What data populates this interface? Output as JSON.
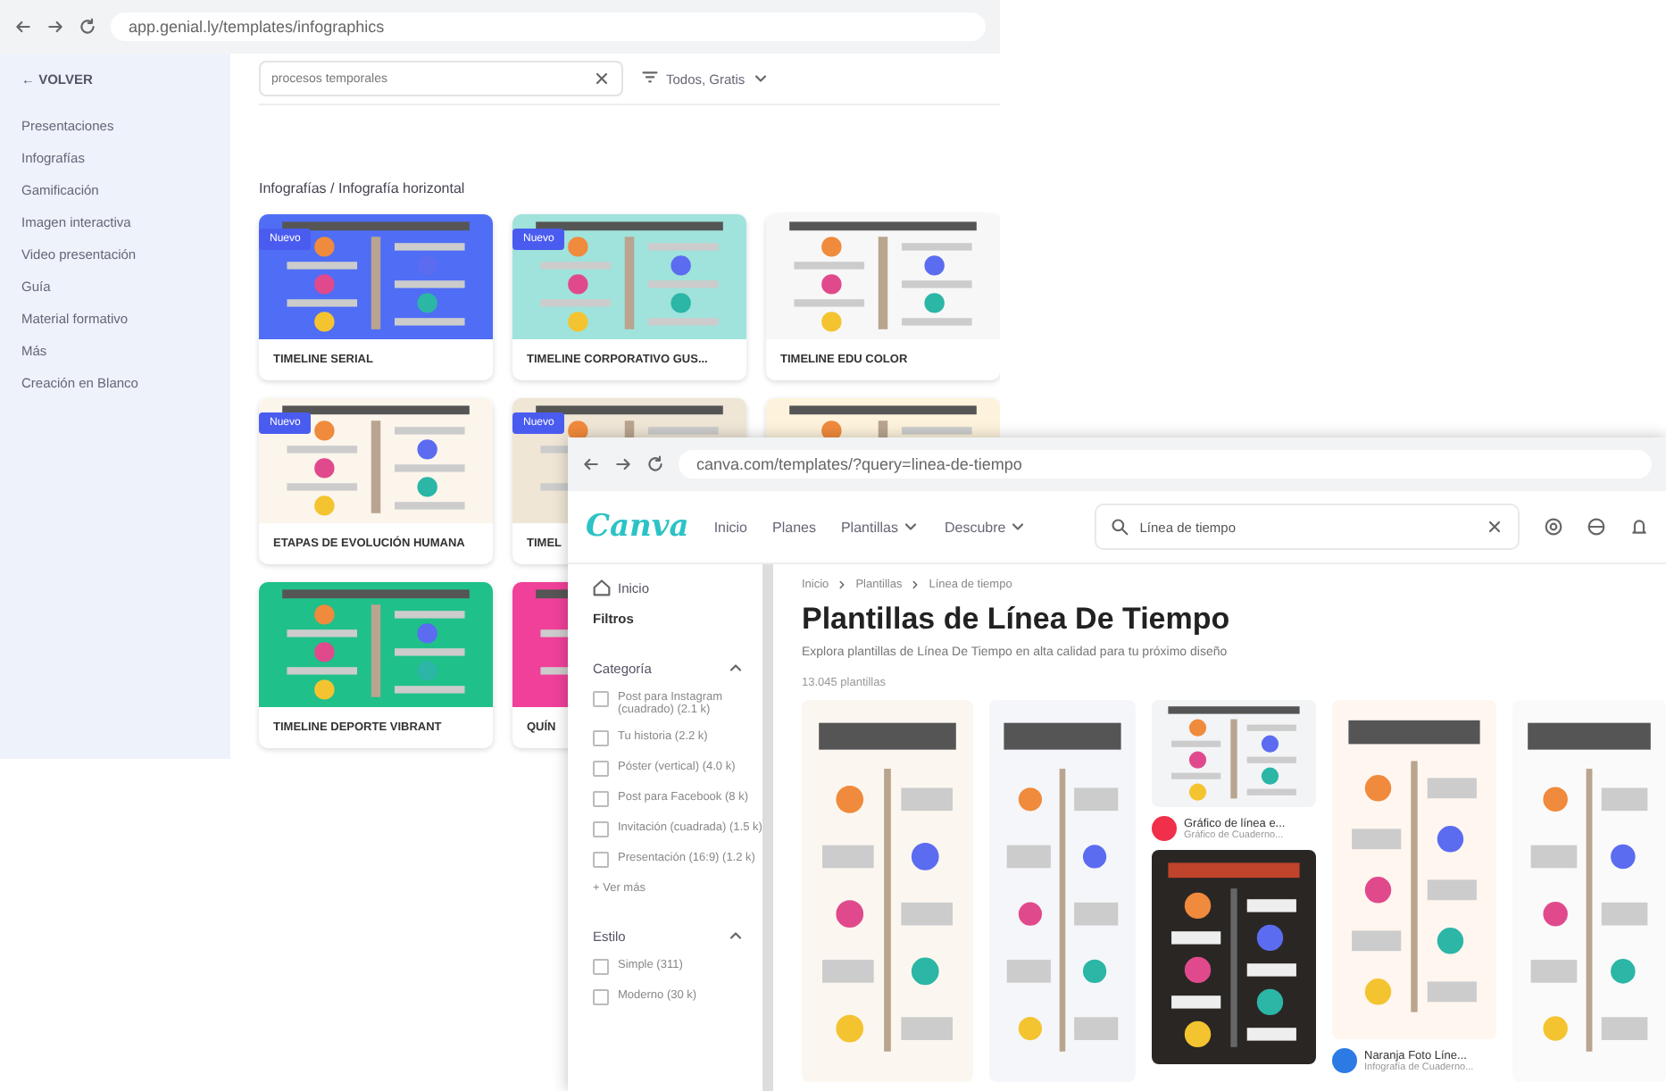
{
  "back_window": {
    "url": "app.genial.ly/templates/infographics",
    "back_link": "← VOLVER",
    "sidebar": {
      "items": [
        "Presentaciones",
        "Infografías",
        "Gamificación",
        "Imagen interactiva",
        "Video presentación",
        "Guía",
        "Material formativo",
        "Más",
        "Creación en Blanco"
      ]
    },
    "search": {
      "value": "procesos temporales"
    },
    "filter": {
      "label": "Todos, Gratis"
    },
    "heading": "Infografías / Infografía horizontal",
    "cards": [
      {
        "title": "TIMELINE SERIAL",
        "badge": "Nuevo",
        "kind": "picture"
      },
      {
        "title": "TIMELINE CORPORATIVO GUS...",
        "badge": "Nuevo",
        "kind": "picture"
      },
      {
        "title": "TIMELINE EDU COLOR",
        "kind": "picture"
      },
      {
        "title": "ETAPAS DE EVOLUCIÓN HUMANA",
        "badge": "Nuevo",
        "kind": "picture"
      },
      {
        "title": "TIMEL",
        "badge": "Nuevo",
        "kind": "picture"
      },
      {
        "kind": "picture"
      },
      {
        "title": "TIMELINE DEPORTE VIBRANT",
        "kind": "picture"
      },
      {
        "title": "QUÍN",
        "kind": "picture"
      }
    ]
  },
  "front_window": {
    "url": "canva.com/templates/?query=linea-de-tiempo",
    "logo": "Canva",
    "nav": [
      {
        "label": "Inicio",
        "dropdown": false
      },
      {
        "label": "Planes",
        "dropdown": false
      },
      {
        "label": "Plantillas",
        "dropdown": true
      },
      {
        "label": "Descubre",
        "dropdown": true
      }
    ],
    "search": {
      "value": "Línea de tiempo"
    },
    "sidebar": {
      "home": "Inicio",
      "filters": "Filtros",
      "groups": [
        {
          "title": "Categoría",
          "expanded": true,
          "options": [
            {
              "label": "Post para Instagram (cuadrado) (2.1 k)",
              "checked": false
            },
            {
              "label": "Tu historia (2.2 k)",
              "checked": false
            },
            {
              "label": "Póster (vertical) (4.0 k)",
              "checked": false
            },
            {
              "label": "Post para Facebook (8 k)",
              "checked": false
            },
            {
              "label": "Invitación (cuadrada) (1.5 k)",
              "checked": false
            },
            {
              "label": "Presentación (16:9) (1.2 k)",
              "checked": false
            }
          ],
          "more": "+ Ver más"
        },
        {
          "title": "Estilo",
          "expanded": true,
          "options": [
            {
              "label": "Simple (311)",
              "checked": false
            },
            {
              "label": "Moderno (30 k)",
              "checked": false
            }
          ]
        }
      ]
    },
    "breadcrumb": [
      "Inicio",
      "Plantillas",
      "Línea de tiempo"
    ],
    "title": "Plantillas de Línea De Tiempo",
    "subtitle": "Explora plantillas de Línea De Tiempo en alta calidad para tu próximo diseño",
    "count": "13.045 plantillas",
    "results": [
      {
        "kind": "picture"
      },
      {
        "kind": "picture"
      },
      {
        "kind": "picture",
        "name": "Gráfico de línea e...",
        "meta": "Gráfico de Cuaderno...",
        "color": "#f0304a"
      },
      {
        "kind": "picture"
      },
      {
        "kind": "picture",
        "name": "Naranja Foto Líne...",
        "meta": "Infografía de Cuaderno...",
        "color": "#2c7be5"
      },
      {
        "kind": "picture"
      }
    ]
  }
}
